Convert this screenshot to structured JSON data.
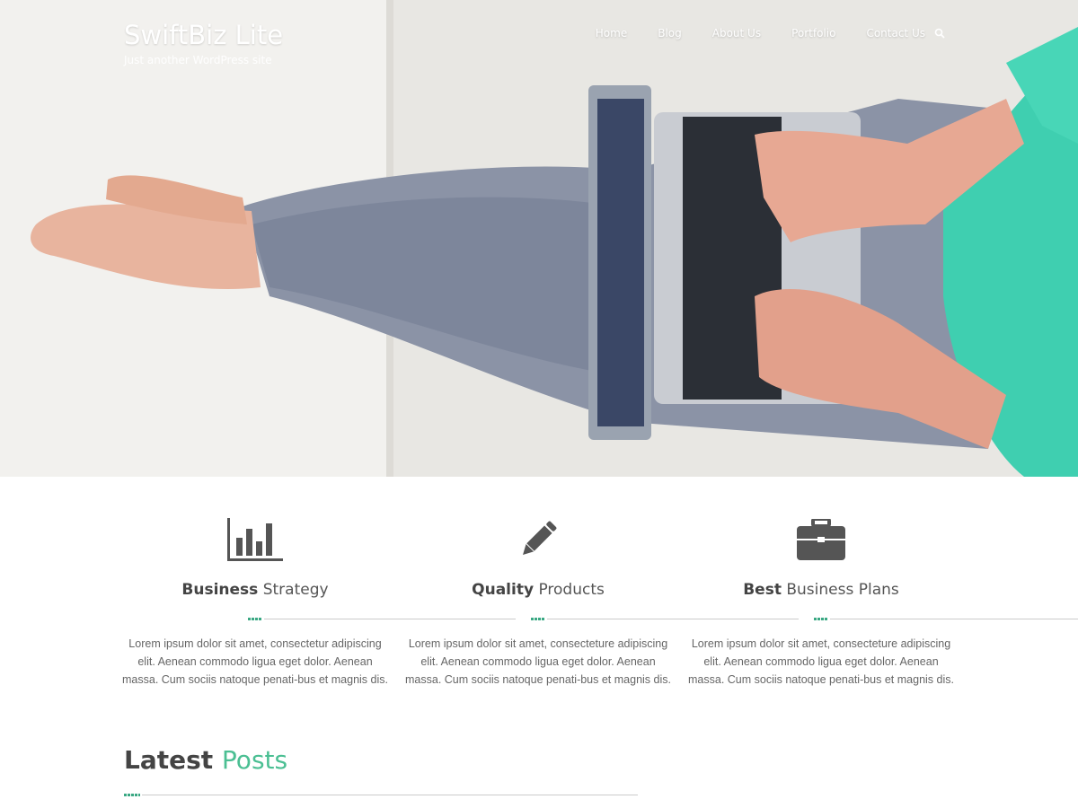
{
  "header": {
    "site_title": "SwiftBiz Lite",
    "tagline": "Just another WordPress site",
    "nav": [
      "Home",
      "Blog",
      "About Us",
      "Portfolio",
      "Contact Us"
    ],
    "search_icon": "search-icon"
  },
  "colors": {
    "accent": "#4bbf93",
    "dots": "#3aa883",
    "text_dark": "#444444",
    "text_body": "#666666"
  },
  "features": [
    {
      "icon": "bar-chart-icon",
      "title_bold": "Business",
      "title_rest": "Strategy",
      "text": "Lorem ipsum dolor sit amet, consectetur adipiscing elit. Aenean commodo ligua eget dolor. Aenean massa. Cum sociis natoque penati-bus et magnis dis."
    },
    {
      "icon": "pencil-icon",
      "title_bold": "Quality",
      "title_rest": "Products",
      "text": "Lorem ipsum dolor sit amet, consecteture adipiscing elit. Aenean commodo ligua eget dolor. Aenean massa. Cum sociis natoque penati-bus et magnis dis."
    },
    {
      "icon": "briefcase-icon",
      "title_bold": "Best",
      "title_rest": "Business Plans",
      "text": "Lorem ipsum dolor sit amet, consecteture adipiscing elit. Aenean commodo ligua eget dolor. Aenean massa. Cum sociis natoque penati-bus et magnis dis."
    }
  ],
  "latest": {
    "title_bold": "Latest",
    "title_accent": "Posts"
  }
}
